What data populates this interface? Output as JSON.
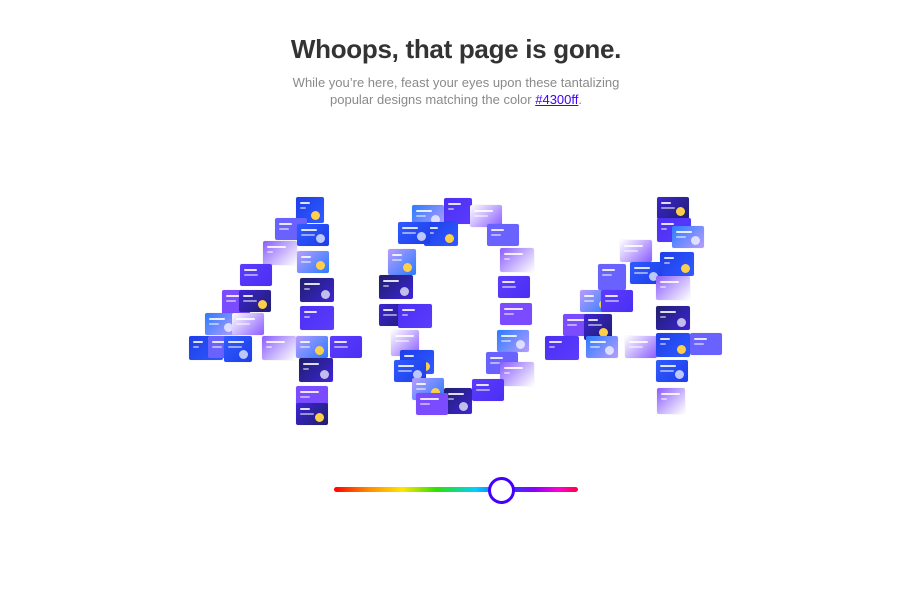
{
  "header": {
    "title": "Whoops, that page is gone.",
    "subtitle_line1": "While you’re here, feast your eyes upon these tantalizing",
    "subtitle_line2_prefix": "popular designs matching the color ",
    "color_link": "#4300ff",
    "subtitle_suffix": "."
  },
  "color_slider": {
    "value": "#4300ff",
    "position_fraction": 0.7
  },
  "colors": {
    "accent": "#4300ff",
    "title": "#333333",
    "subtitle": "#8a8a8a"
  },
  "mosaic": {
    "thumbnail_palette": [
      "#4a2ff2",
      "#2f5bff",
      "#7b4bff",
      "#1e3de8",
      "#5c3cff",
      "#2a7bff",
      "#8a5cff",
      "#3d24d6",
      "#6a62ff",
      "#1f1f6b",
      "#ffffff",
      "#b79dff"
    ],
    "thumbnail_count": 72
  }
}
